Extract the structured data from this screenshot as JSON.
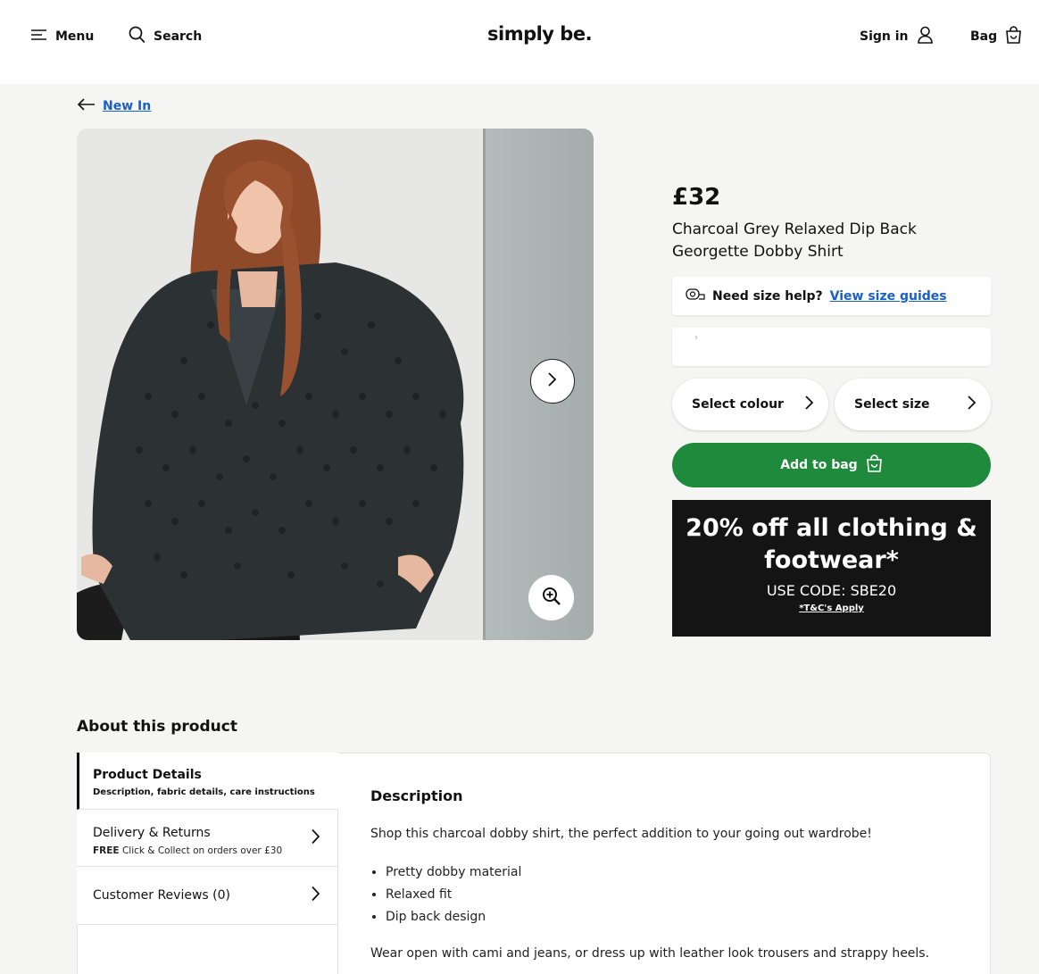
{
  "header": {
    "menu_label": "Menu",
    "search_label": "Search",
    "logo": "simply be.",
    "sign_in_label": "Sign in",
    "bag_label": "Bag"
  },
  "breadcrumb": {
    "back_label": "New In"
  },
  "product": {
    "price": "£32",
    "title": "Charcoal Grey Relaxed Dip Back Georgette Dobby Shirt",
    "size_help": {
      "prompt": "Need size help?",
      "link": "View size guides"
    },
    "empty_box_marker": "›",
    "select_colour_label": "Select colour",
    "select_size_label": "Select size",
    "add_to_bag_label": "Add to bag"
  },
  "promo": {
    "headline": "20% off all clothing & footwear*",
    "code_line": "USE CODE: SBE20",
    "terms": "*T&C's Apply"
  },
  "about": {
    "title": "About this product",
    "tabs": [
      {
        "title": "Product Details",
        "subtitle": "Description, fabric details, care instructions"
      },
      {
        "title": "Delivery & Returns",
        "subtitle_bold": "FREE",
        "subtitle_rest": " Click & Collect on orders over £30"
      },
      {
        "title": "Customer Reviews (0)"
      }
    ],
    "description": {
      "heading": "Description",
      "intro": "Shop this charcoal dobby shirt, the perfect addition to your going out wardrobe!",
      "bullets": [
        "Pretty dobby material",
        "Relaxed fit",
        "Dip back design"
      ],
      "outro": "Wear open with cami and jeans, or dress up with leather look trousers and strappy heels."
    }
  },
  "colors": {
    "accent_green": "#1f8a3c",
    "link_blue": "#1a5ec8",
    "promo_bg": "#141414",
    "page_bg": "#f5f5f3"
  },
  "icons": [
    "menu-icon",
    "search-icon",
    "user-icon",
    "bag-icon",
    "arrow-left-icon",
    "chevron-right-icon",
    "zoom-in-icon",
    "tape-measure-icon"
  ]
}
